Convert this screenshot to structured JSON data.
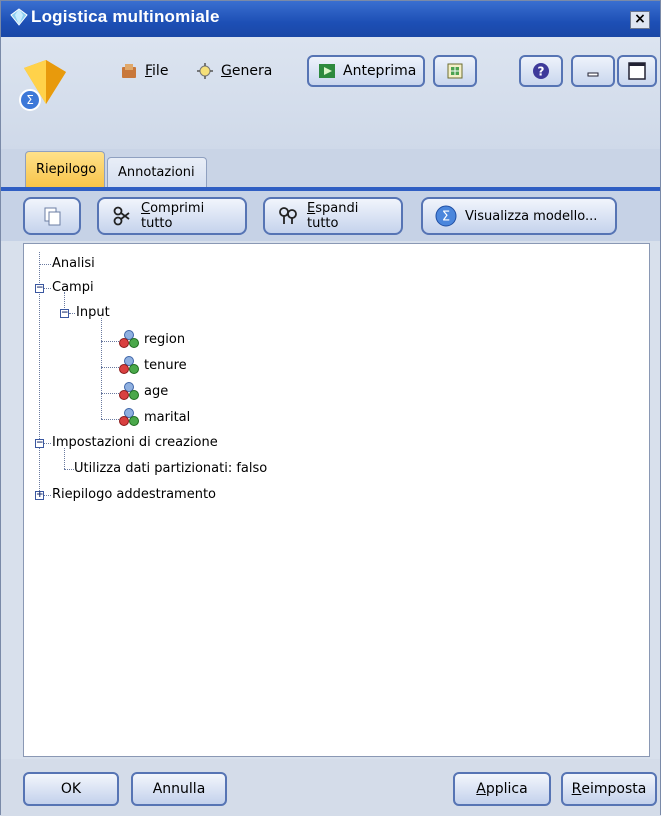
{
  "window": {
    "title": "Logistica multinomiale",
    "close_label": "×"
  },
  "toolbar": {
    "file": {
      "label_first": "F",
      "label_rest": "ile",
      "icon": "file-icon"
    },
    "genera": {
      "label_first": "G",
      "label_rest": "enera",
      "icon": "generate-icon"
    },
    "anteprima": {
      "label": "Anteprima",
      "icon": "preview-icon"
    },
    "export": {
      "icon": "export-icon"
    },
    "help": {
      "icon": "help-icon"
    },
    "minimize": {
      "icon": "minimize-icon"
    },
    "maximize": {
      "icon": "maximize-icon"
    }
  },
  "tabs": [
    {
      "label": "Riepilogo",
      "active": true
    },
    {
      "label": "Annotazioni",
      "active": false
    }
  ],
  "actions": {
    "copy": {
      "icon": "copy-icon"
    },
    "collapse": {
      "label_first": "C",
      "label_rest": "omprimi tutto",
      "icon": "collapse-icon"
    },
    "expand": {
      "label_first": "E",
      "label_rest": "spandi tutto",
      "icon": "expand-icon"
    },
    "view_model": {
      "label": "Visualizza modello...",
      "icon": "sigma-icon"
    }
  },
  "tree": {
    "analisi": "Analisi",
    "campi": "Campi",
    "input": "Input",
    "fields": [
      "region",
      "tenure",
      "age",
      "marital"
    ],
    "impostazioni": "Impostazioni di creazione",
    "partizionati": "Utilizza dati partizionati: falso",
    "riepilogo": "Riepilogo addestramento"
  },
  "footer": {
    "ok": "OK",
    "annulla": "Annulla",
    "applica_first": "A",
    "applica_rest": "pplica",
    "reimposta_first": "R",
    "reimposta_rest": "eimposta"
  },
  "colors": {
    "title_bar": "#1d4fb5",
    "active_tab": "#f8c44a",
    "accent_border": "#5674b4"
  }
}
